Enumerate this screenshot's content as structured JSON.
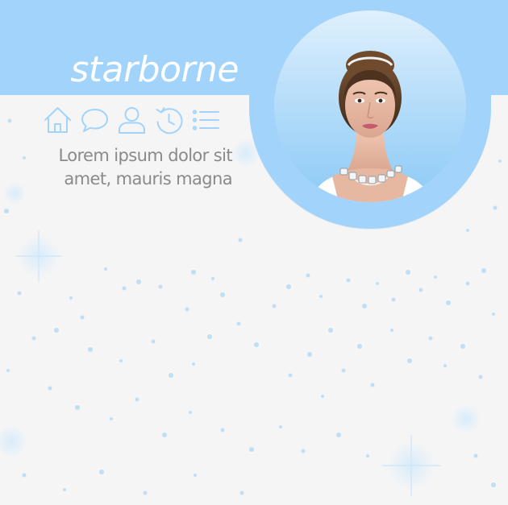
{
  "header": {
    "title": "starborne",
    "band_color": "#a2d4fb"
  },
  "nav": {
    "items": [
      {
        "icon": "home-icon"
      },
      {
        "icon": "speech-bubble-icon"
      },
      {
        "icon": "person-icon"
      },
      {
        "icon": "history-clock-icon"
      },
      {
        "icon": "list-icon"
      }
    ],
    "icon_color": "#a2d4fb"
  },
  "description": {
    "text": "Lorem ipsum dolor sit amet, mauris magna"
  },
  "avatar": {
    "subject": "portrait photo"
  },
  "colors": {
    "background": "#f5f5f6",
    "text": "#8a8a8a",
    "title": "#ffffff"
  }
}
